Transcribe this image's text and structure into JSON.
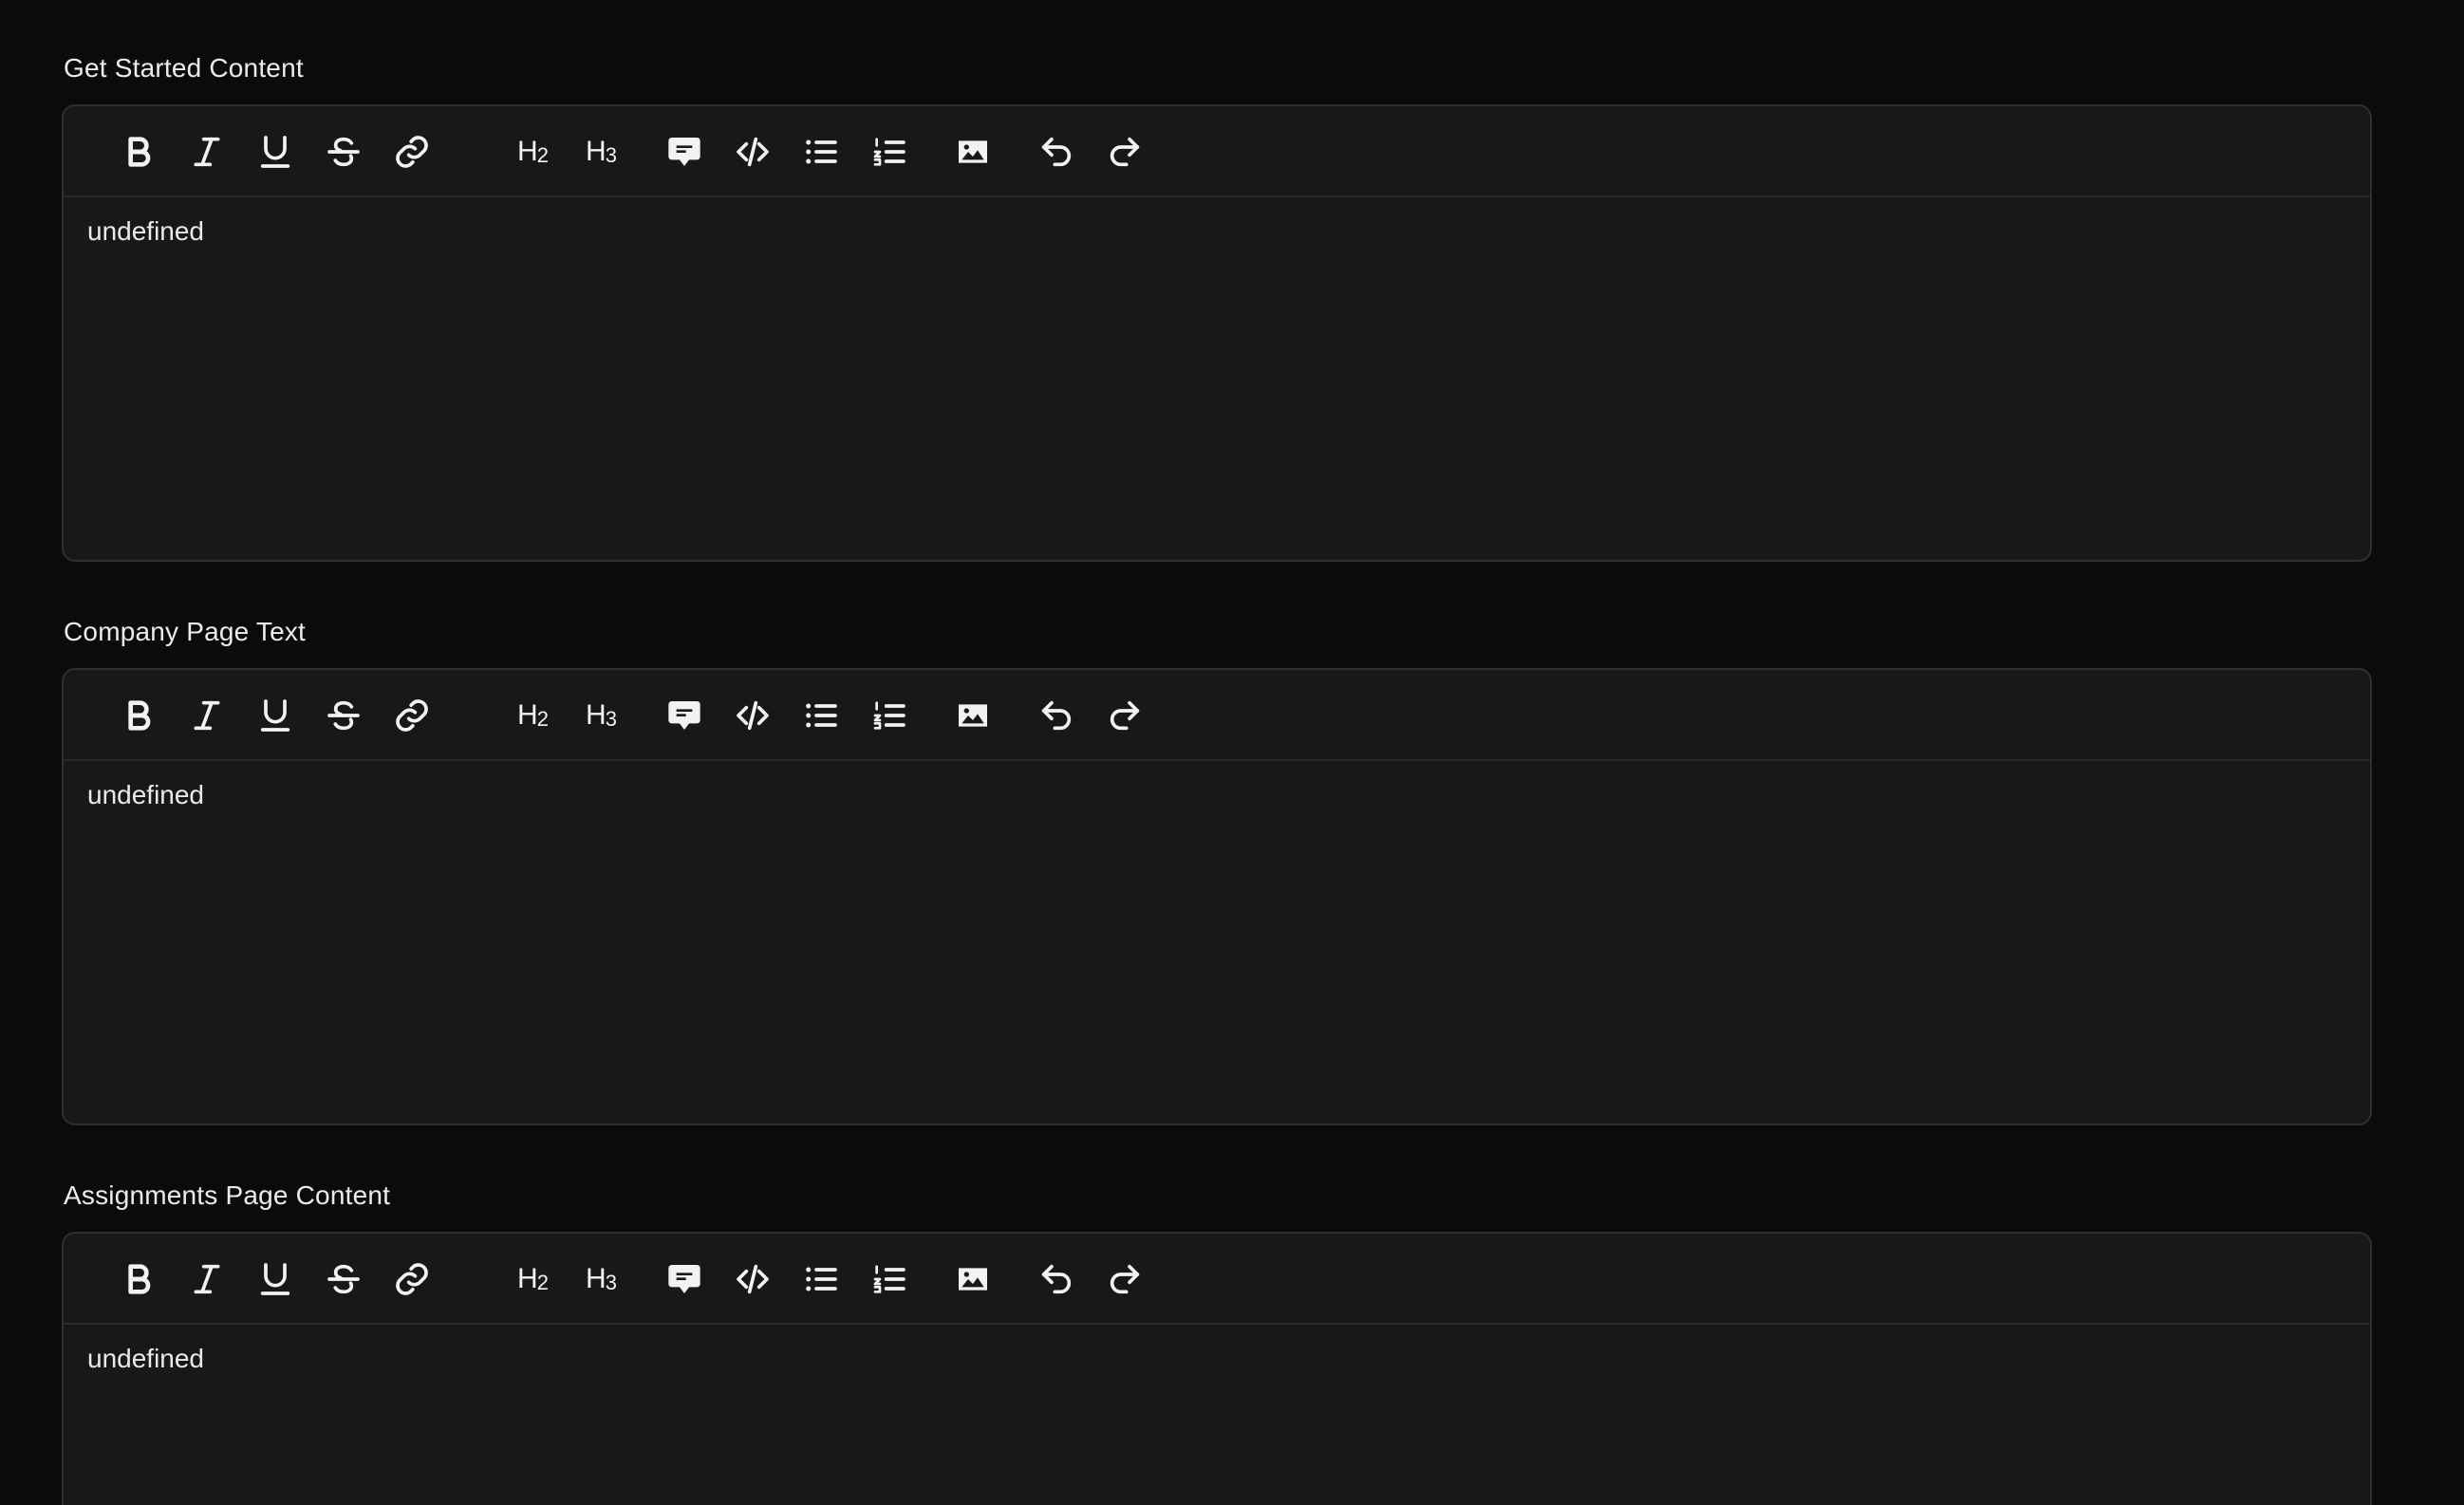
{
  "editors": [
    {
      "label": "Get Started Content",
      "content": "undefined"
    },
    {
      "label": "Company Page Text",
      "content": "undefined"
    },
    {
      "label": "Assignments Page Content",
      "content": "undefined"
    }
  ],
  "toolbar": {
    "h2_label": "H",
    "h2_sub": "2",
    "h3_label": "H",
    "h3_sub": "3",
    "icons": [
      "bold-icon",
      "italic-icon",
      "underline-icon",
      "strikethrough-icon",
      "link-icon",
      "heading-2-icon",
      "heading-3-icon",
      "comment-icon",
      "code-icon",
      "bullet-list-icon",
      "ordered-list-icon",
      "image-icon",
      "undo-icon",
      "redo-icon"
    ]
  },
  "colors": {
    "background": "#0b0b0d",
    "editor_bg": "#181818",
    "border": "#2f2f2f",
    "text": "#ededed"
  }
}
